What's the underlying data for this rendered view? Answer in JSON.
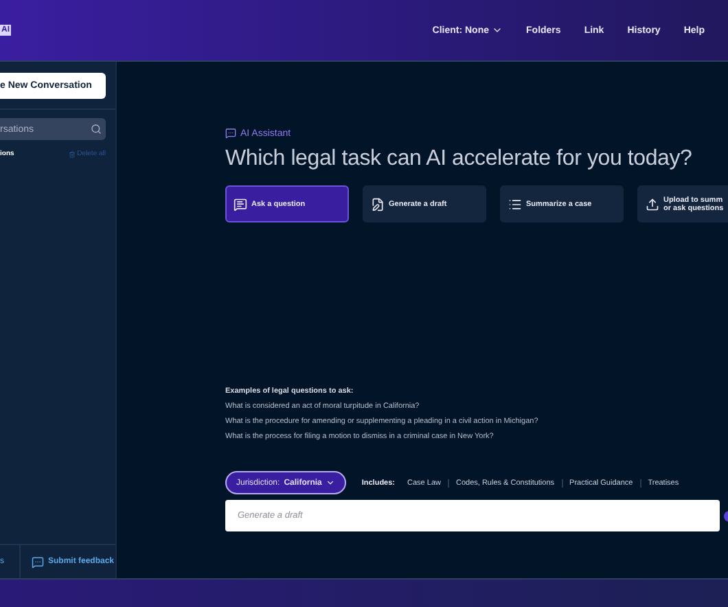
{
  "header": {
    "logo": "AI",
    "nav": [
      {
        "label": "Client: None",
        "kind": "dropdown"
      },
      {
        "label": "Folders",
        "kind": "link"
      },
      {
        "label": "Link",
        "kind": "link"
      },
      {
        "label": "History",
        "kind": "link"
      },
      {
        "label": "Help",
        "kind": "link"
      }
    ]
  },
  "sidebar": {
    "new_button": "e New Conversation",
    "search": {
      "placeholder": "rsations"
    },
    "section_label": "ions",
    "delete_all": "Delete all",
    "footer": [
      {
        "label": "s",
        "kind": "text"
      },
      {
        "label": "Submit feedback",
        "kind": "feedback"
      }
    ]
  },
  "main": {
    "badge": "AI Assistant",
    "headline": "Which legal task can AI accelerate for you today?",
    "tasks": [
      {
        "label": "Ask a question",
        "kind": "chat",
        "selected": true
      },
      {
        "label": "Generate a draft",
        "kind": "draft",
        "selected": false
      },
      {
        "label": "Summarize a case",
        "kind": "list",
        "selected": false
      },
      {
        "label": "Upload to summ\nor ask questions",
        "kind": "upload",
        "selected": false
      }
    ],
    "examples_title": "Examples of legal questions to ask:",
    "examples": [
      "What is considered an act of moral turpitude in California?",
      "What is the procedure for amending or supplementing a pleading in a civil action in Michigan?",
      "What is the process for filing a motion to dismiss in a criminal case in New York?"
    ],
    "jurisdiction": {
      "label": "Jurisdiction:",
      "value": "California"
    },
    "includes_label": "Includes:",
    "includes": [
      "Case Law",
      "Codes, Rules & Constitutions",
      "Practical Guidance",
      "Treatises"
    ],
    "input": {
      "placeholder": "Generate a draft"
    }
  }
}
